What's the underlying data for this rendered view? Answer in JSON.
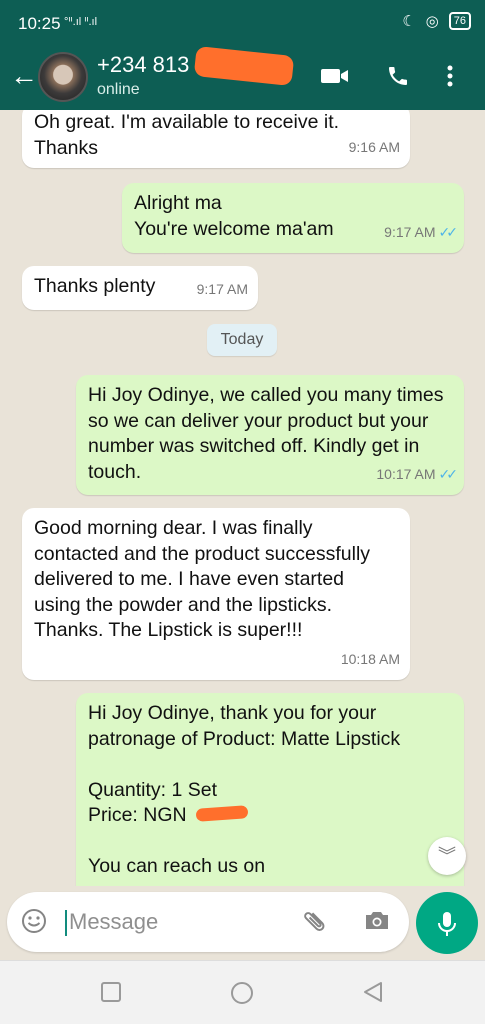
{
  "status_bar": {
    "time": "10:25",
    "signal": "°ᐦ.ıl ᐦ.ıl",
    "battery": "76"
  },
  "header": {
    "contact_name": "+234 813",
    "contact_status": "online",
    "icons": [
      "back-arrow-icon",
      "avatar",
      "video-call-icon",
      "voice-call-icon",
      "more-options-icon"
    ]
  },
  "messages": [
    {
      "direction": "in",
      "text": "Oh great. I'm available to receive it. Thanks",
      "time": "9:16 AM"
    },
    {
      "direction": "out",
      "text": "Alright ma\nYou're welcome ma'am",
      "time": "9:17 AM",
      "read": true
    },
    {
      "direction": "in",
      "text": "Thanks plenty",
      "time": "9:17 AM"
    },
    {
      "direction": "out",
      "text": "Hi Joy Odinye, we called you many times so we can deliver your product but your number was switched off. Kindly get in touch.",
      "time": "10:17 AM",
      "read": true
    },
    {
      "direction": "in",
      "text": "Good morning dear. I was finally contacted and the product successfully delivered to me. I have even started using the powder and the lipsticks. Thanks. The Lipstick is super!!!",
      "time": "10:18 AM"
    },
    {
      "direction": "out",
      "text": "Hi Joy Odinye, thank you for your patronage of Product: Matte Lipstick\n\nQuantity: 1 Set\nPrice: NGN\n\nYou can reach us on"
    }
  ],
  "day_divider": "Today",
  "composer": {
    "placeholder": "Message"
  },
  "colors": {
    "header": "#0d5e54",
    "incoming": "#ffffff",
    "outgoing": "#dcf8c6",
    "background": "#e9e3d8",
    "accent": "#00a884",
    "read_ticks": "#4fb4e8"
  }
}
